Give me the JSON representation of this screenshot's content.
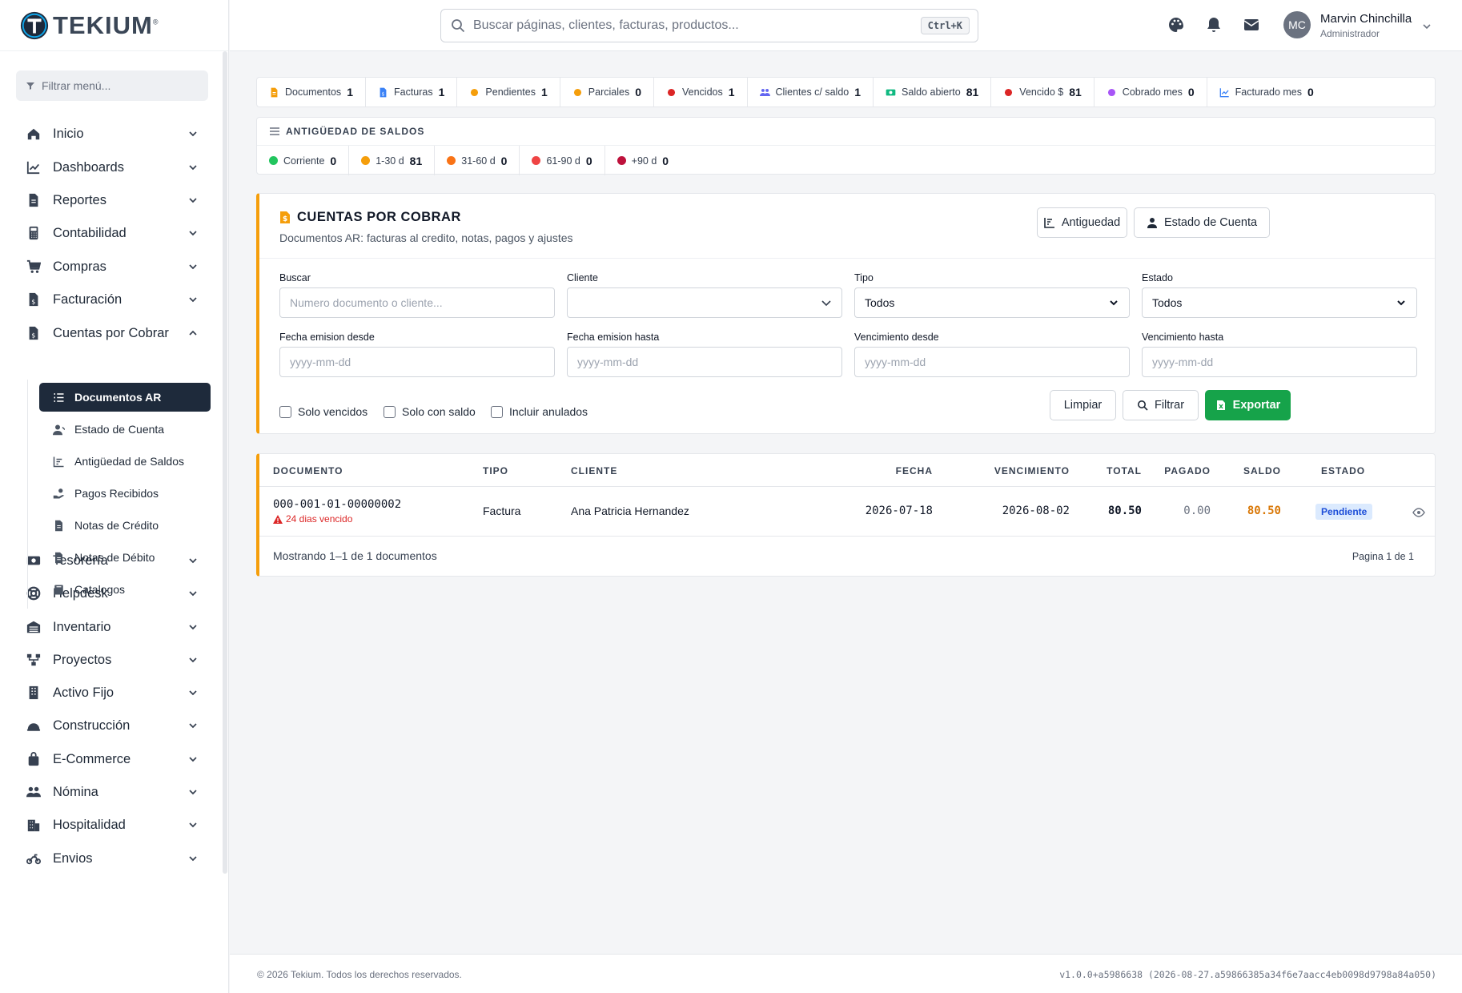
{
  "brand": {
    "name": "TEKIUM",
    "mark": "®",
    "color": "#1e2a3b"
  },
  "sidebar": {
    "filter_placeholder": "Filtrar menú...",
    "items": [
      {
        "label": "Inicio",
        "icon": "home-icon"
      },
      {
        "label": "Dashboards",
        "icon": "chart-line-icon"
      },
      {
        "label": "Reportes",
        "icon": "file-icon"
      },
      {
        "label": "Contabilidad",
        "icon": "calculator-icon"
      },
      {
        "label": "Compras",
        "icon": "cart-icon"
      },
      {
        "label": "Facturación",
        "icon": "invoice-icon"
      },
      {
        "label": "Cuentas por Cobrar",
        "icon": "receivable-icon",
        "expanded": true
      },
      {
        "label": "Tesorería",
        "icon": "money-icon"
      },
      {
        "label": "Helpdesk",
        "icon": "lifebuoy-icon"
      },
      {
        "label": "Inventario",
        "icon": "warehouse-icon"
      },
      {
        "label": "Proyectos",
        "icon": "project-icon"
      },
      {
        "label": "Activo Fijo",
        "icon": "building-icon"
      },
      {
        "label": "Construcción",
        "icon": "helmet-icon"
      },
      {
        "label": "E-Commerce",
        "icon": "bag-icon"
      },
      {
        "label": "Nómina",
        "icon": "users-icon"
      },
      {
        "label": "Hospitalidad",
        "icon": "hotel-icon"
      },
      {
        "label": "Envios",
        "icon": "motorcycle-icon"
      }
    ],
    "subitems": [
      {
        "label": "Documentos AR",
        "icon": "list-icon",
        "active": true
      },
      {
        "label": "Estado de Cuenta",
        "icon": "user-icon"
      },
      {
        "label": "Antigüedad de Saldos",
        "icon": "chart-icon"
      },
      {
        "label": "Pagos Recibidos",
        "icon": "hand-coin-icon"
      },
      {
        "label": "Notas de Crédito",
        "icon": "file-icon"
      },
      {
        "label": "Notas de Débito",
        "icon": "file-icon"
      },
      {
        "label": "Catalogos",
        "icon": "book-icon"
      }
    ]
  },
  "topbar": {
    "search_placeholder": "Buscar páginas, clientes, facturas, productos...",
    "shortcut": "Ctrl+K",
    "user": {
      "initials": "MC",
      "name": "Marvin Chinchilla",
      "role": "Administrador"
    }
  },
  "stats": [
    {
      "label": "Documentos",
      "value": "1",
      "icon": "file-icon",
      "color": "#f59e0b"
    },
    {
      "label": "Facturas",
      "value": "1",
      "icon": "invoice-icon",
      "color": "#3b82f6"
    },
    {
      "label": "Pendientes",
      "value": "1",
      "icon": "clock-icon",
      "color": "#f59e0b"
    },
    {
      "label": "Parciales",
      "value": "0",
      "icon": "spinner-icon",
      "color": "#f59e0b"
    },
    {
      "label": "Vencidos",
      "value": "1",
      "icon": "alert-icon",
      "color": "#dc2626"
    },
    {
      "label": "Clientes c/ saldo",
      "value": "1",
      "icon": "users-icon",
      "color": "#6366f1"
    },
    {
      "label": "Saldo abierto",
      "value": "81",
      "icon": "money-icon",
      "color": "#10b981"
    },
    {
      "label": "Vencido $",
      "value": "81",
      "icon": "fire-icon",
      "color": "#dc2626"
    },
    {
      "label": "Cobrado mes",
      "value": "0",
      "icon": "calendar-icon",
      "color": "#a855f7"
    },
    {
      "label": "Facturado mes",
      "value": "0",
      "icon": "chart-line-icon",
      "color": "#3b82f6"
    }
  ],
  "aging": {
    "title": "ANTIGÜEDAD DE SALDOS",
    "buckets": [
      {
        "label": "Corriente",
        "value": "0",
        "color": "#22c55e"
      },
      {
        "label": "1-30 d",
        "value": "81",
        "color": "#f59e0b"
      },
      {
        "label": "31-60 d",
        "value": "0",
        "color": "#f97316"
      },
      {
        "label": "61-90 d",
        "value": "0",
        "color": "#ef4444"
      },
      {
        "label": "+90 d",
        "value": "0",
        "color": "#be123c"
      }
    ]
  },
  "card": {
    "title": "CUENTAS POR COBRAR",
    "subtitle": "Documentos AR: facturas al credito, notas, pagos y ajustes",
    "btn_aging": "Antiguedad",
    "btn_statement": "Estado de Cuenta",
    "filters": {
      "buscar_label": "Buscar",
      "buscar_placeholder": "Numero documento o cliente...",
      "cliente_label": "Cliente",
      "cliente_value": "",
      "tipo_label": "Tipo",
      "tipo_value": "Todos",
      "estado_label": "Estado",
      "estado_value": "Todos",
      "fecha_desde_label": "Fecha emision desde",
      "fecha_hasta_label": "Fecha emision hasta",
      "venc_desde_label": "Vencimiento desde",
      "venc_hasta_label": "Vencimiento hasta",
      "date_placeholder": "yyyy-mm-dd"
    },
    "checks": {
      "solo_vencidos": "Solo vencidos",
      "solo_saldo": "Solo con saldo",
      "incluir_anulados": "Incluir anulados"
    },
    "btn_clear": "Limpiar",
    "btn_filter": "Filtrar",
    "btn_export": "Exportar"
  },
  "table": {
    "headers": [
      "DOCUMENTO",
      "TIPO",
      "CLIENTE",
      "FECHA",
      "VENCIMIENTO",
      "TOTAL",
      "PAGADO",
      "SALDO",
      "ESTADO"
    ],
    "rows": [
      {
        "documento": "000-001-01-00000002",
        "overdue": "24 dias vencido",
        "tipo": "Factura",
        "cliente": "Ana Patricia Hernandez",
        "fecha": "2026-07-18",
        "vencimiento": "2026-08-02",
        "total": "80.50",
        "pagado": "0.00",
        "saldo": "80.50",
        "estado": "Pendiente"
      }
    ],
    "showing": "Mostrando 1–1 de 1 documentos",
    "pagination": "Pagina 1 de 1"
  },
  "footer": {
    "copyright": "© 2026 Tekium. Todos los derechos reservados.",
    "version": "v1.0.0+a5986638 (2026-08-27.a59866385a34f6e7aacc4eb0098d9798a84a050)"
  }
}
